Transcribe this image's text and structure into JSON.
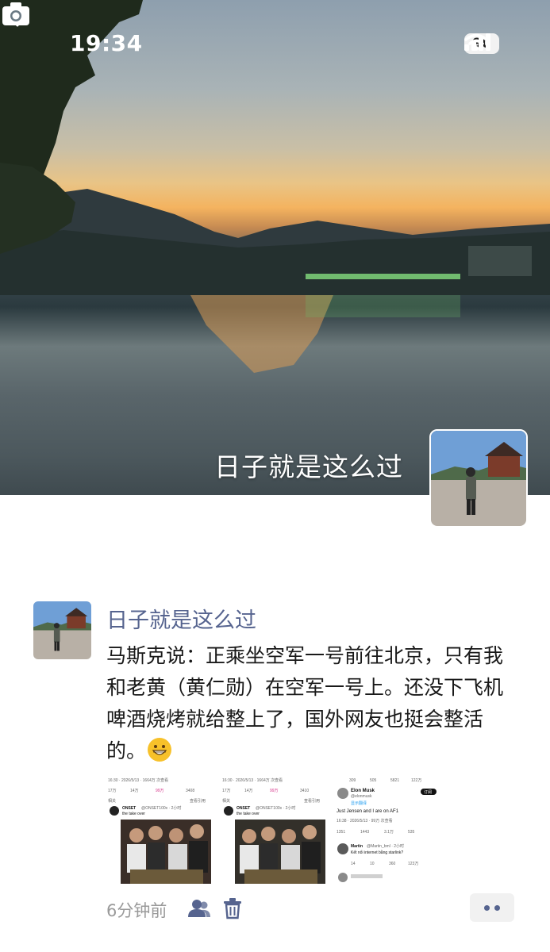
{
  "status_bar": {
    "time": "19:34",
    "battery": "90",
    "icons": [
      "signal-icon",
      "wifi-icon",
      "battery-icon"
    ]
  },
  "header": {
    "back_icon": "chevron-left-icon",
    "camera_icon": "camera-icon"
  },
  "cover": {
    "user_name": "日子就是这么过"
  },
  "post": {
    "author": "日子就是这么过",
    "text": "马斯克说：正乘坐空军一号前往北京，只有我和老黄（黄仁勋）在空军一号上。还没下飞机啤酒烧烤就给整上了，国外网友也挺会整活的。",
    "emoji": "grinning-face-emoji",
    "images": [
      {
        "meta": "16:30 · 2026/5/13 · 1664万 次查看",
        "stats": [
          "17万",
          "14万",
          "99万",
          "3408"
        ],
        "tab_left": "相关",
        "tab_right": "查看引用",
        "tweet_author": "ONSET",
        "tweet_handle": "@ONSET100x · 2小时",
        "tweet_text": "the take over"
      },
      {
        "meta": "16:30 · 2026/5/13 · 1664万 次查看",
        "stats": [
          "17万",
          "14万",
          "99万",
          "3410"
        ],
        "tab_left": "相关",
        "tab_right": "查看引用",
        "tweet_author": "ONSET",
        "tweet_handle": "@ONSET100x · 2小时",
        "tweet_text": "the take over"
      },
      {
        "top_stats": [
          "309",
          "505",
          "5821",
          "122万"
        ],
        "author": "Elon Musk",
        "handle": "@elonmusk",
        "follow": "订阅",
        "translate": "显示翻译",
        "text": "Just Jensen and I are on AF1",
        "meta": "16:38 · 2026/5/13 · 99万 次查看",
        "stats": [
          "1351",
          "1443",
          "3.1万",
          "535"
        ],
        "reply_author": "Martin",
        "reply_handle": "@Martin_bml · 2小时",
        "reply_text": "Kết nối internet bằng starlink?",
        "reply_stats": [
          "14",
          "10",
          "360",
          "123万"
        ]
      }
    ],
    "time": "6分钟前",
    "footer_icons": [
      "friends-icon",
      "trash-icon",
      "more-icon"
    ]
  },
  "colors": {
    "name_blue": "#56648f",
    "meta_gray": "#9a9a9a"
  }
}
